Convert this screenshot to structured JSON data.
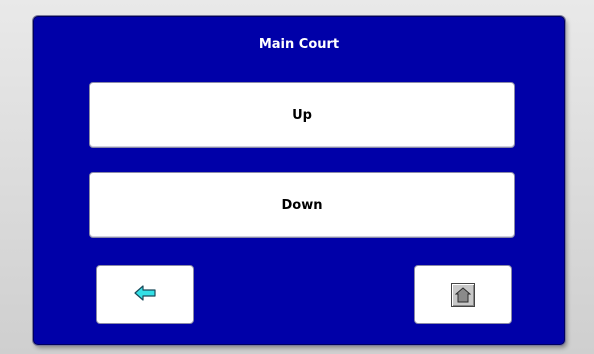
{
  "panel": {
    "title": "Main Court",
    "bg_color": "#0000a8"
  },
  "buttons": {
    "up_label": "Up",
    "down_label": "Down",
    "back_icon": "left-arrow-icon",
    "home_icon": "home-icon"
  },
  "colors": {
    "arrow": "#33e0e6",
    "button_bg": "#ffffff"
  }
}
